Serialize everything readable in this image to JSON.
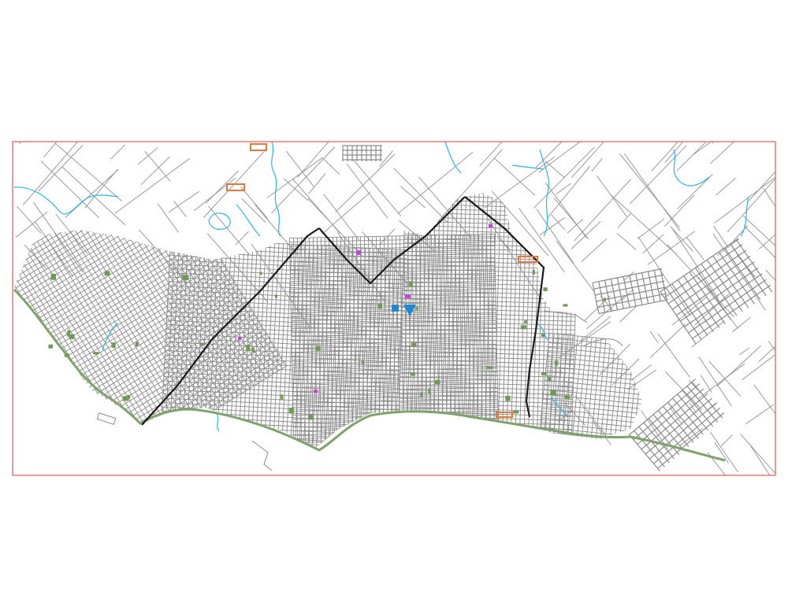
{
  "drawing": {
    "frame_color": "#e05a5a",
    "street_color": "#8a8a8a",
    "major_road_color": "#1a1a1a",
    "river_color": "#29b6e8",
    "coast_green": "#7fa36a",
    "park_green": "#6f9a55",
    "orange_marker": "#e07a3a",
    "magenta_marker": "#c04ad0",
    "blue_marker": "#1e8ad6"
  }
}
